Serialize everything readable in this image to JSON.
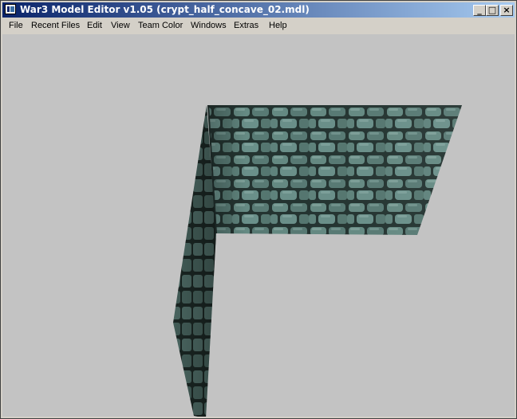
{
  "window": {
    "title": "War3 Model Editor v1.05 (crypt_half_concave_02.mdl)",
    "controls": {
      "minimize": "_",
      "maximize": "□",
      "close": "×"
    }
  },
  "menu": {
    "items": [
      "File",
      "Recent Files",
      "Edit",
      "View",
      "Team Color",
      "Windows",
      "Extras",
      "Help"
    ]
  },
  "viewport": {
    "background": "#c3c3c3",
    "model": "crypt half concave wall with stone brick texture"
  },
  "colors": {
    "title_start": "#0a246a",
    "title_end": "#a6caf0",
    "stone": "#5f7f79",
    "mortar": "#233330"
  }
}
